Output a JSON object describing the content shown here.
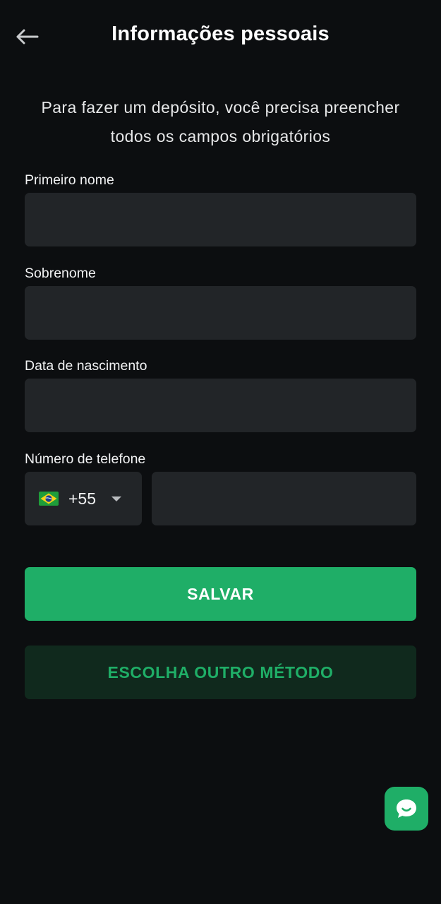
{
  "header": {
    "title": "Informações pessoais",
    "back_icon": "arrow-left-icon"
  },
  "intro": {
    "text": "Para fazer um depósito, você precisa preencher todos os campos obrigatórios"
  },
  "form": {
    "first_name": {
      "label": "Primeiro nome",
      "value": "",
      "placeholder": ""
    },
    "last_name": {
      "label": "Sobrenome",
      "value": "",
      "placeholder": ""
    },
    "birth_date": {
      "label": "Data de nascimento",
      "value": "",
      "placeholder": ""
    },
    "phone": {
      "label": "Número de telefone",
      "country_flag_icon": "brazil-flag-icon",
      "dial_code": "+55",
      "value": "",
      "placeholder": ""
    }
  },
  "actions": {
    "save_label": "SALVAR",
    "other_method_label": "ESCOLHA OUTRO MÉTODO"
  },
  "chat": {
    "icon": "chat-bubble-icon"
  },
  "colors": {
    "background": "#0c0e10",
    "input": "#222528",
    "accent": "#1fae67",
    "secondary_button": "#10291d"
  }
}
